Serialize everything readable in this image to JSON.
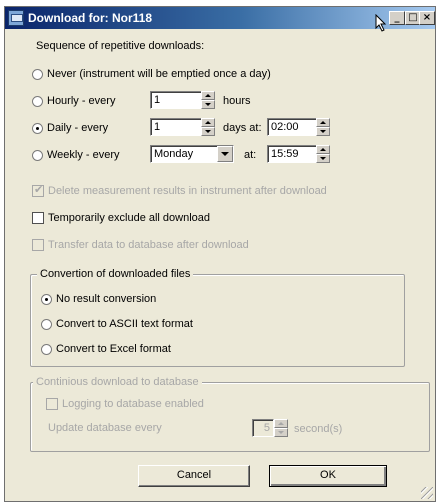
{
  "window": {
    "title": "Download for: Nor118"
  },
  "titlebar": {
    "minimize": "_",
    "maximize": "□",
    "close": "×"
  },
  "schedule": {
    "heading": "Sequence of repetitive downloads:",
    "never_label": "Never (instrument will be emptied once a day)",
    "hourly_label": "Hourly  -  every",
    "hourly_value": "1",
    "hourly_unit": "hours",
    "daily_label": "Daily  -  every",
    "daily_value": "1",
    "daily_unit": "days at:",
    "daily_time": "02:00",
    "weekly_label": "Weekly  -  every",
    "weekly_day": "Monday",
    "weekly_at": "at:",
    "weekly_time": "15:59",
    "selected": "Daily"
  },
  "options": {
    "delete_label": "Delete measurement results in instrument after download",
    "delete_checked": true,
    "delete_enabled": false,
    "exclude_label": "Temporarily exclude all download",
    "exclude_checked": false,
    "transfer_label": "Transfer data to database after download",
    "transfer_checked": false,
    "transfer_enabled": false
  },
  "conversion": {
    "title": "Convertion of downloaded files",
    "none_label": "No result conversion",
    "ascii_label": "Convert to ASCII text format",
    "excel_label": "Convert to Excel format",
    "selected": "No result conversion"
  },
  "continuous": {
    "title": "Continious download to database",
    "logging_label": "Logging to database enabled",
    "logging_checked": false,
    "update_label": "Update database every",
    "update_value": "5",
    "update_unit": "second(s)",
    "enabled": false
  },
  "buttons": {
    "cancel": "Cancel",
    "ok": "OK"
  },
  "icons": [
    "app-icon",
    "cursor-icon",
    "minimize-icon",
    "maximize-icon",
    "close-icon",
    "spin-up-icon",
    "spin-down-icon",
    "dropdown-arrow-icon",
    "size-grip-icon"
  ]
}
